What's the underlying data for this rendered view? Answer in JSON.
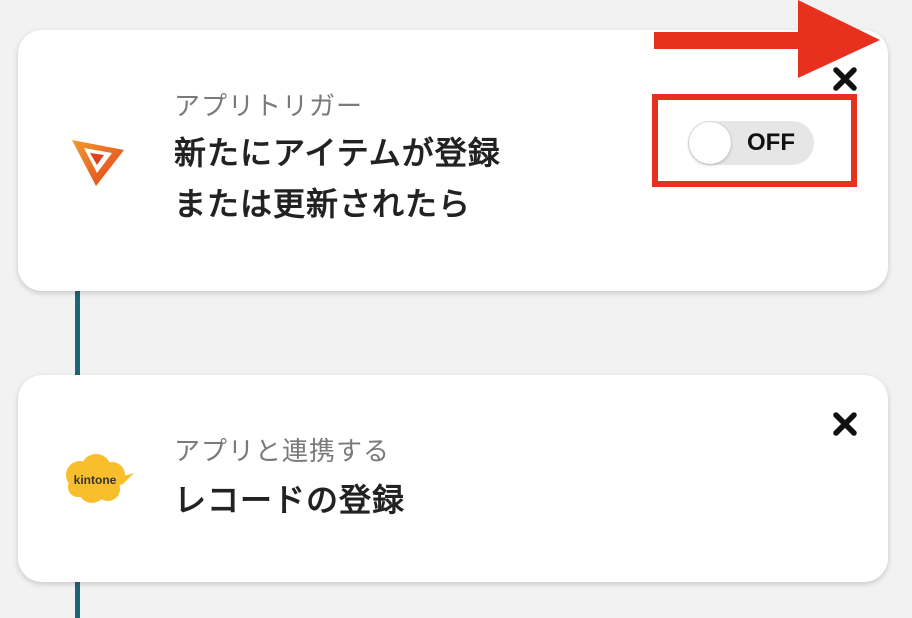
{
  "flow": {
    "trigger": {
      "label": "アプリトリガー",
      "title_line1": "新たにアイテムが登録",
      "title_line2": "または更新されたら",
      "icon": "app-logo-icon",
      "toggle": {
        "state": "OFF",
        "on": false
      }
    },
    "action": {
      "label": "アプリと連携する",
      "title": "レコードの登録",
      "icon": "kintone-logo-icon",
      "logo_text": "kintone"
    }
  },
  "colors": {
    "background": "#f2f2f2",
    "connector": "#1f6475",
    "annotation_red": "#e8301f",
    "kintone_yellow": "#f9be2c"
  }
}
